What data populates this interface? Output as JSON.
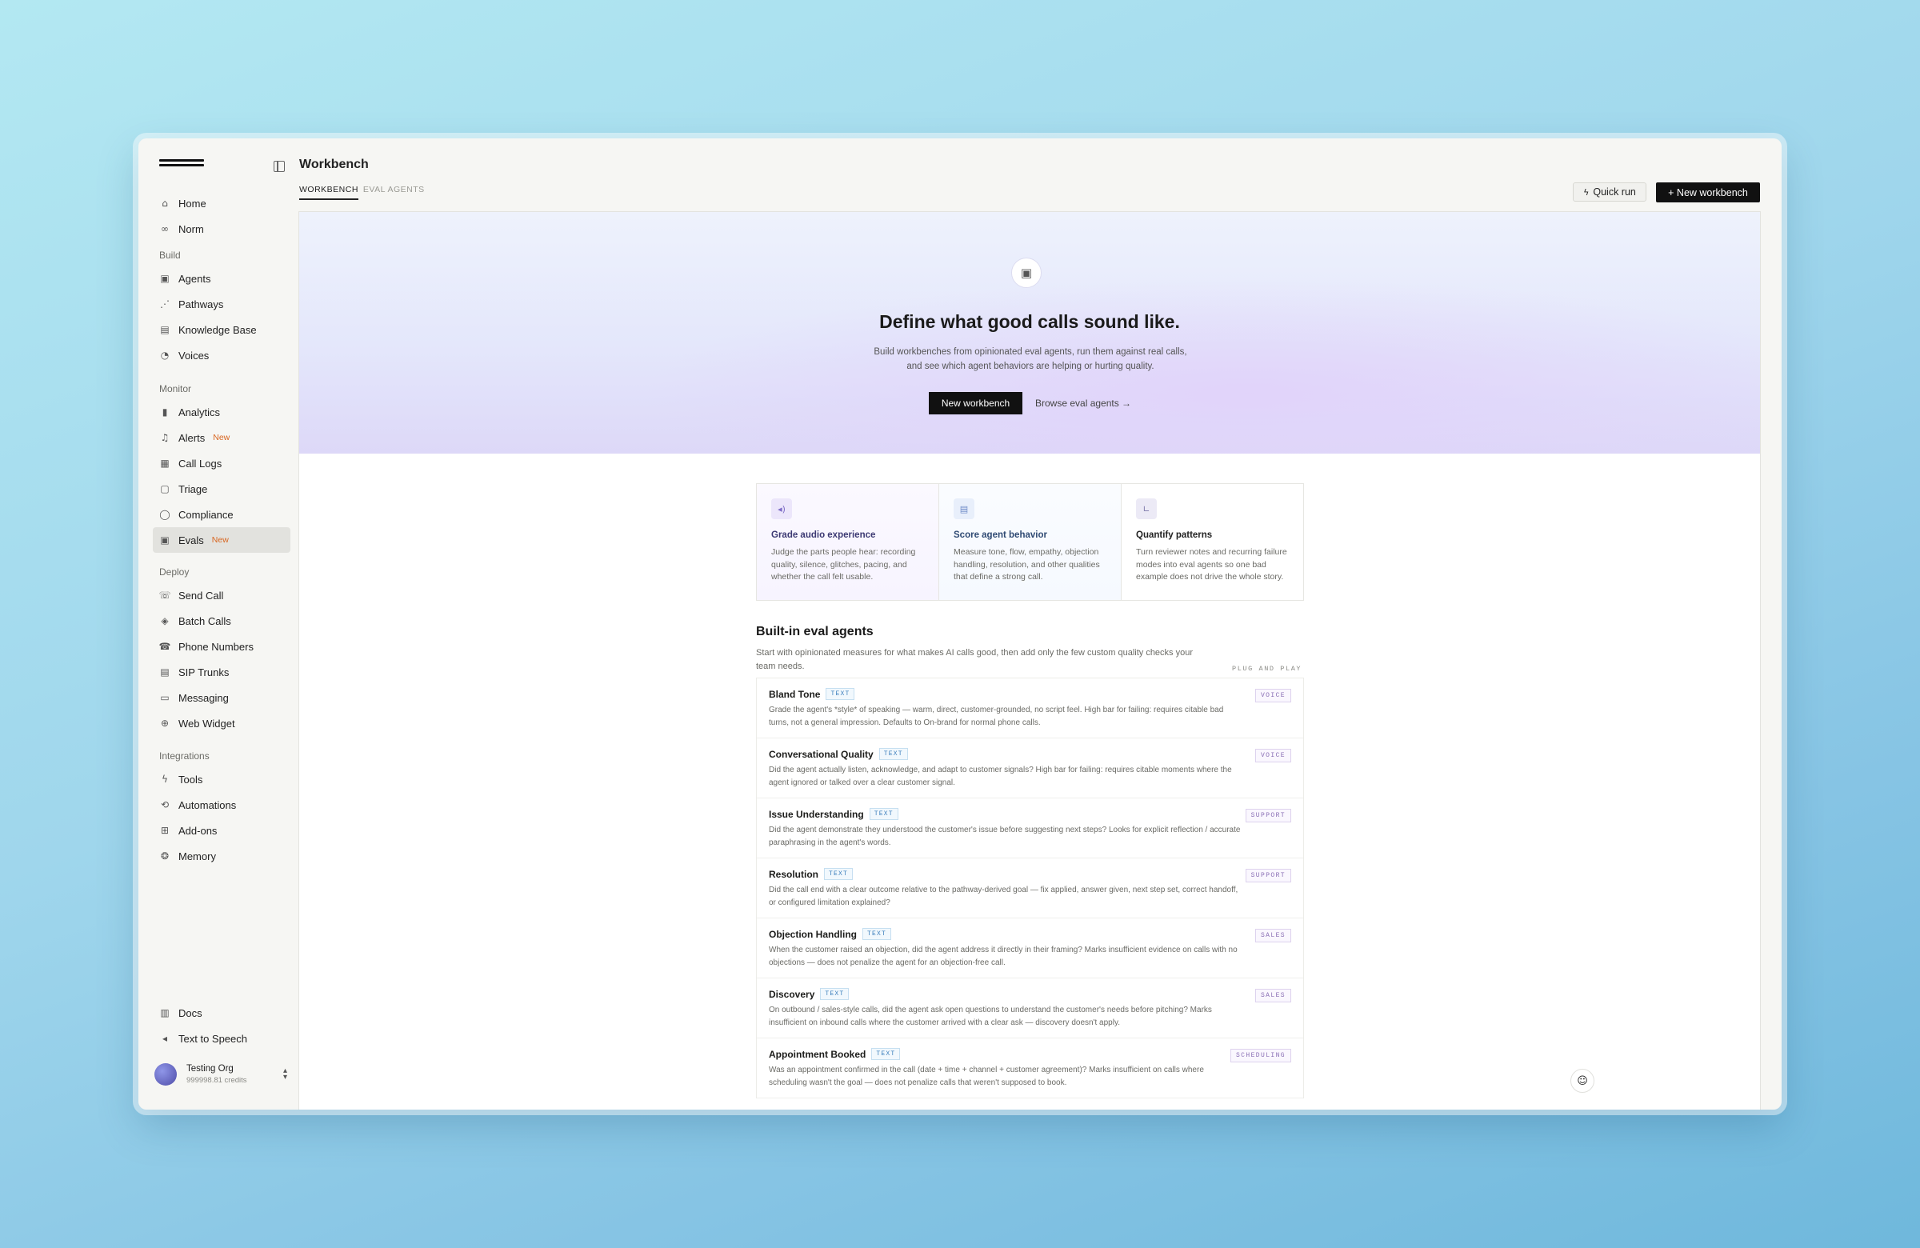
{
  "sidebar": {
    "top_items": [
      {
        "label": "Home",
        "icon": "home-icon"
      },
      {
        "label": "Norm",
        "icon": "norm-icon"
      }
    ],
    "sections": [
      {
        "title": "Build",
        "items": [
          {
            "label": "Agents",
            "icon": "agent-icon"
          },
          {
            "label": "Pathways",
            "icon": "pathway-icon"
          },
          {
            "label": "Knowledge Base",
            "icon": "document-icon"
          },
          {
            "label": "Voices",
            "icon": "voice-icon"
          }
        ]
      },
      {
        "title": "Monitor",
        "items": [
          {
            "label": "Analytics",
            "icon": "bar-chart-icon"
          },
          {
            "label": "Alerts",
            "icon": "bell-icon",
            "badge": "New"
          },
          {
            "label": "Call Logs",
            "icon": "table-icon"
          },
          {
            "label": "Triage",
            "icon": "clipboard-icon"
          },
          {
            "label": "Compliance",
            "icon": "shield-icon"
          },
          {
            "label": "Evals",
            "icon": "clipboard-check-icon",
            "badge": "New",
            "active": true
          }
        ]
      },
      {
        "title": "Deploy",
        "items": [
          {
            "label": "Send Call",
            "icon": "phone-outgoing-icon"
          },
          {
            "label": "Batch Calls",
            "icon": "layers-icon"
          },
          {
            "label": "Phone Numbers",
            "icon": "phone-icon"
          },
          {
            "label": "SIP Trunks",
            "icon": "server-icon"
          },
          {
            "label": "Messaging",
            "icon": "message-icon"
          },
          {
            "label": "Web Widget",
            "icon": "globe-icon"
          }
        ]
      },
      {
        "title": "Integrations",
        "items": [
          {
            "label": "Tools",
            "icon": "bolt-icon"
          },
          {
            "label": "Automations",
            "icon": "automation-icon"
          },
          {
            "label": "Add-ons",
            "icon": "puzzle-icon"
          },
          {
            "label": "Memory",
            "icon": "brain-icon"
          }
        ]
      }
    ],
    "bottom_items": [
      {
        "label": "Docs",
        "icon": "book-icon"
      },
      {
        "label": "Text to Speech",
        "icon": "speaker-icon"
      }
    ],
    "org": {
      "name": "Testing Org",
      "credits": "999998.81 credits"
    }
  },
  "header": {
    "title": "Workbench",
    "tabs": [
      {
        "label": "Workbench",
        "active": true
      },
      {
        "label": "Eval Agents",
        "active": false
      }
    ],
    "quick_run_label": "Quick run",
    "new_workbench_label": "+  New workbench"
  },
  "hero": {
    "title": "Define what good calls sound like.",
    "description": "Build workbenches from opinionated eval agents, run them against real calls, and see which agent behaviors are helping or hurting quality.",
    "primary_button": "New workbench",
    "secondary_link": "Browse eval agents →"
  },
  "features": [
    {
      "title": "Grade audio experience",
      "description": "Judge the parts people hear: recording quality, silence, glitches, pacing, and whether the call felt usable.",
      "icon": "speaker-icon"
    },
    {
      "title": "Score agent behavior",
      "description": "Measure tone, flow, empathy, objection handling, resolution, and other qualities that define a strong call.",
      "icon": "document-icon"
    },
    {
      "title": "Quantify patterns",
      "description": "Turn reviewer notes and recurring failure modes into eval agents so one bad example does not drive the whole story.",
      "icon": "line-chart-icon"
    }
  ],
  "builtin": {
    "title": "Built-in eval agents",
    "description": "Start with opinionated measures for what makes AI calls good, then add only the few custom quality checks your team needs.",
    "tag": "PLUG AND PLAY",
    "agents": [
      {
        "name": "Bland Tone",
        "type": "TEXT",
        "category": "VOICE",
        "description": "Grade the agent's *style* of speaking — warm, direct, customer-grounded, no script feel. High bar for failing: requires citable bad turns, not a general impression. Defaults to On-brand for normal phone calls."
      },
      {
        "name": "Conversational Quality",
        "type": "TEXT",
        "category": "VOICE",
        "description": "Did the agent actually listen, acknowledge, and adapt to customer signals? High bar for failing: requires citable moments where the agent ignored or talked over a clear customer signal."
      },
      {
        "name": "Issue Understanding",
        "type": "TEXT",
        "category": "SUPPORT",
        "description": "Did the agent demonstrate they understood the customer's issue before suggesting next steps? Looks for explicit reflection / accurate paraphrasing in the agent's words."
      },
      {
        "name": "Resolution",
        "type": "TEXT",
        "category": "SUPPORT",
        "description": "Did the call end with a clear outcome relative to the pathway-derived goal — fix applied, answer given, next step set, correct handoff, or configured limitation explained?"
      },
      {
        "name": "Objection Handling",
        "type": "TEXT",
        "category": "SALES",
        "description": "When the customer raised an objection, did the agent address it directly in their framing? Marks insufficient evidence on calls with no objections — does not penalize the agent for an objection-free call."
      },
      {
        "name": "Discovery",
        "type": "TEXT",
        "category": "SALES",
        "description": "On outbound / sales-style calls, did the agent ask open questions to understand the customer's needs before pitching? Marks insufficient on inbound calls where the customer arrived with a clear ask — discovery doesn't apply."
      },
      {
        "name": "Appointment Booked",
        "type": "TEXT",
        "category": "SCHEDULING",
        "description": "Was an appointment confirmed in the call (date + time + channel + customer agreement)? Marks insufficient on calls where scheduling wasn't the goal — does not penalize calls that weren't supposed to book."
      }
    ]
  }
}
